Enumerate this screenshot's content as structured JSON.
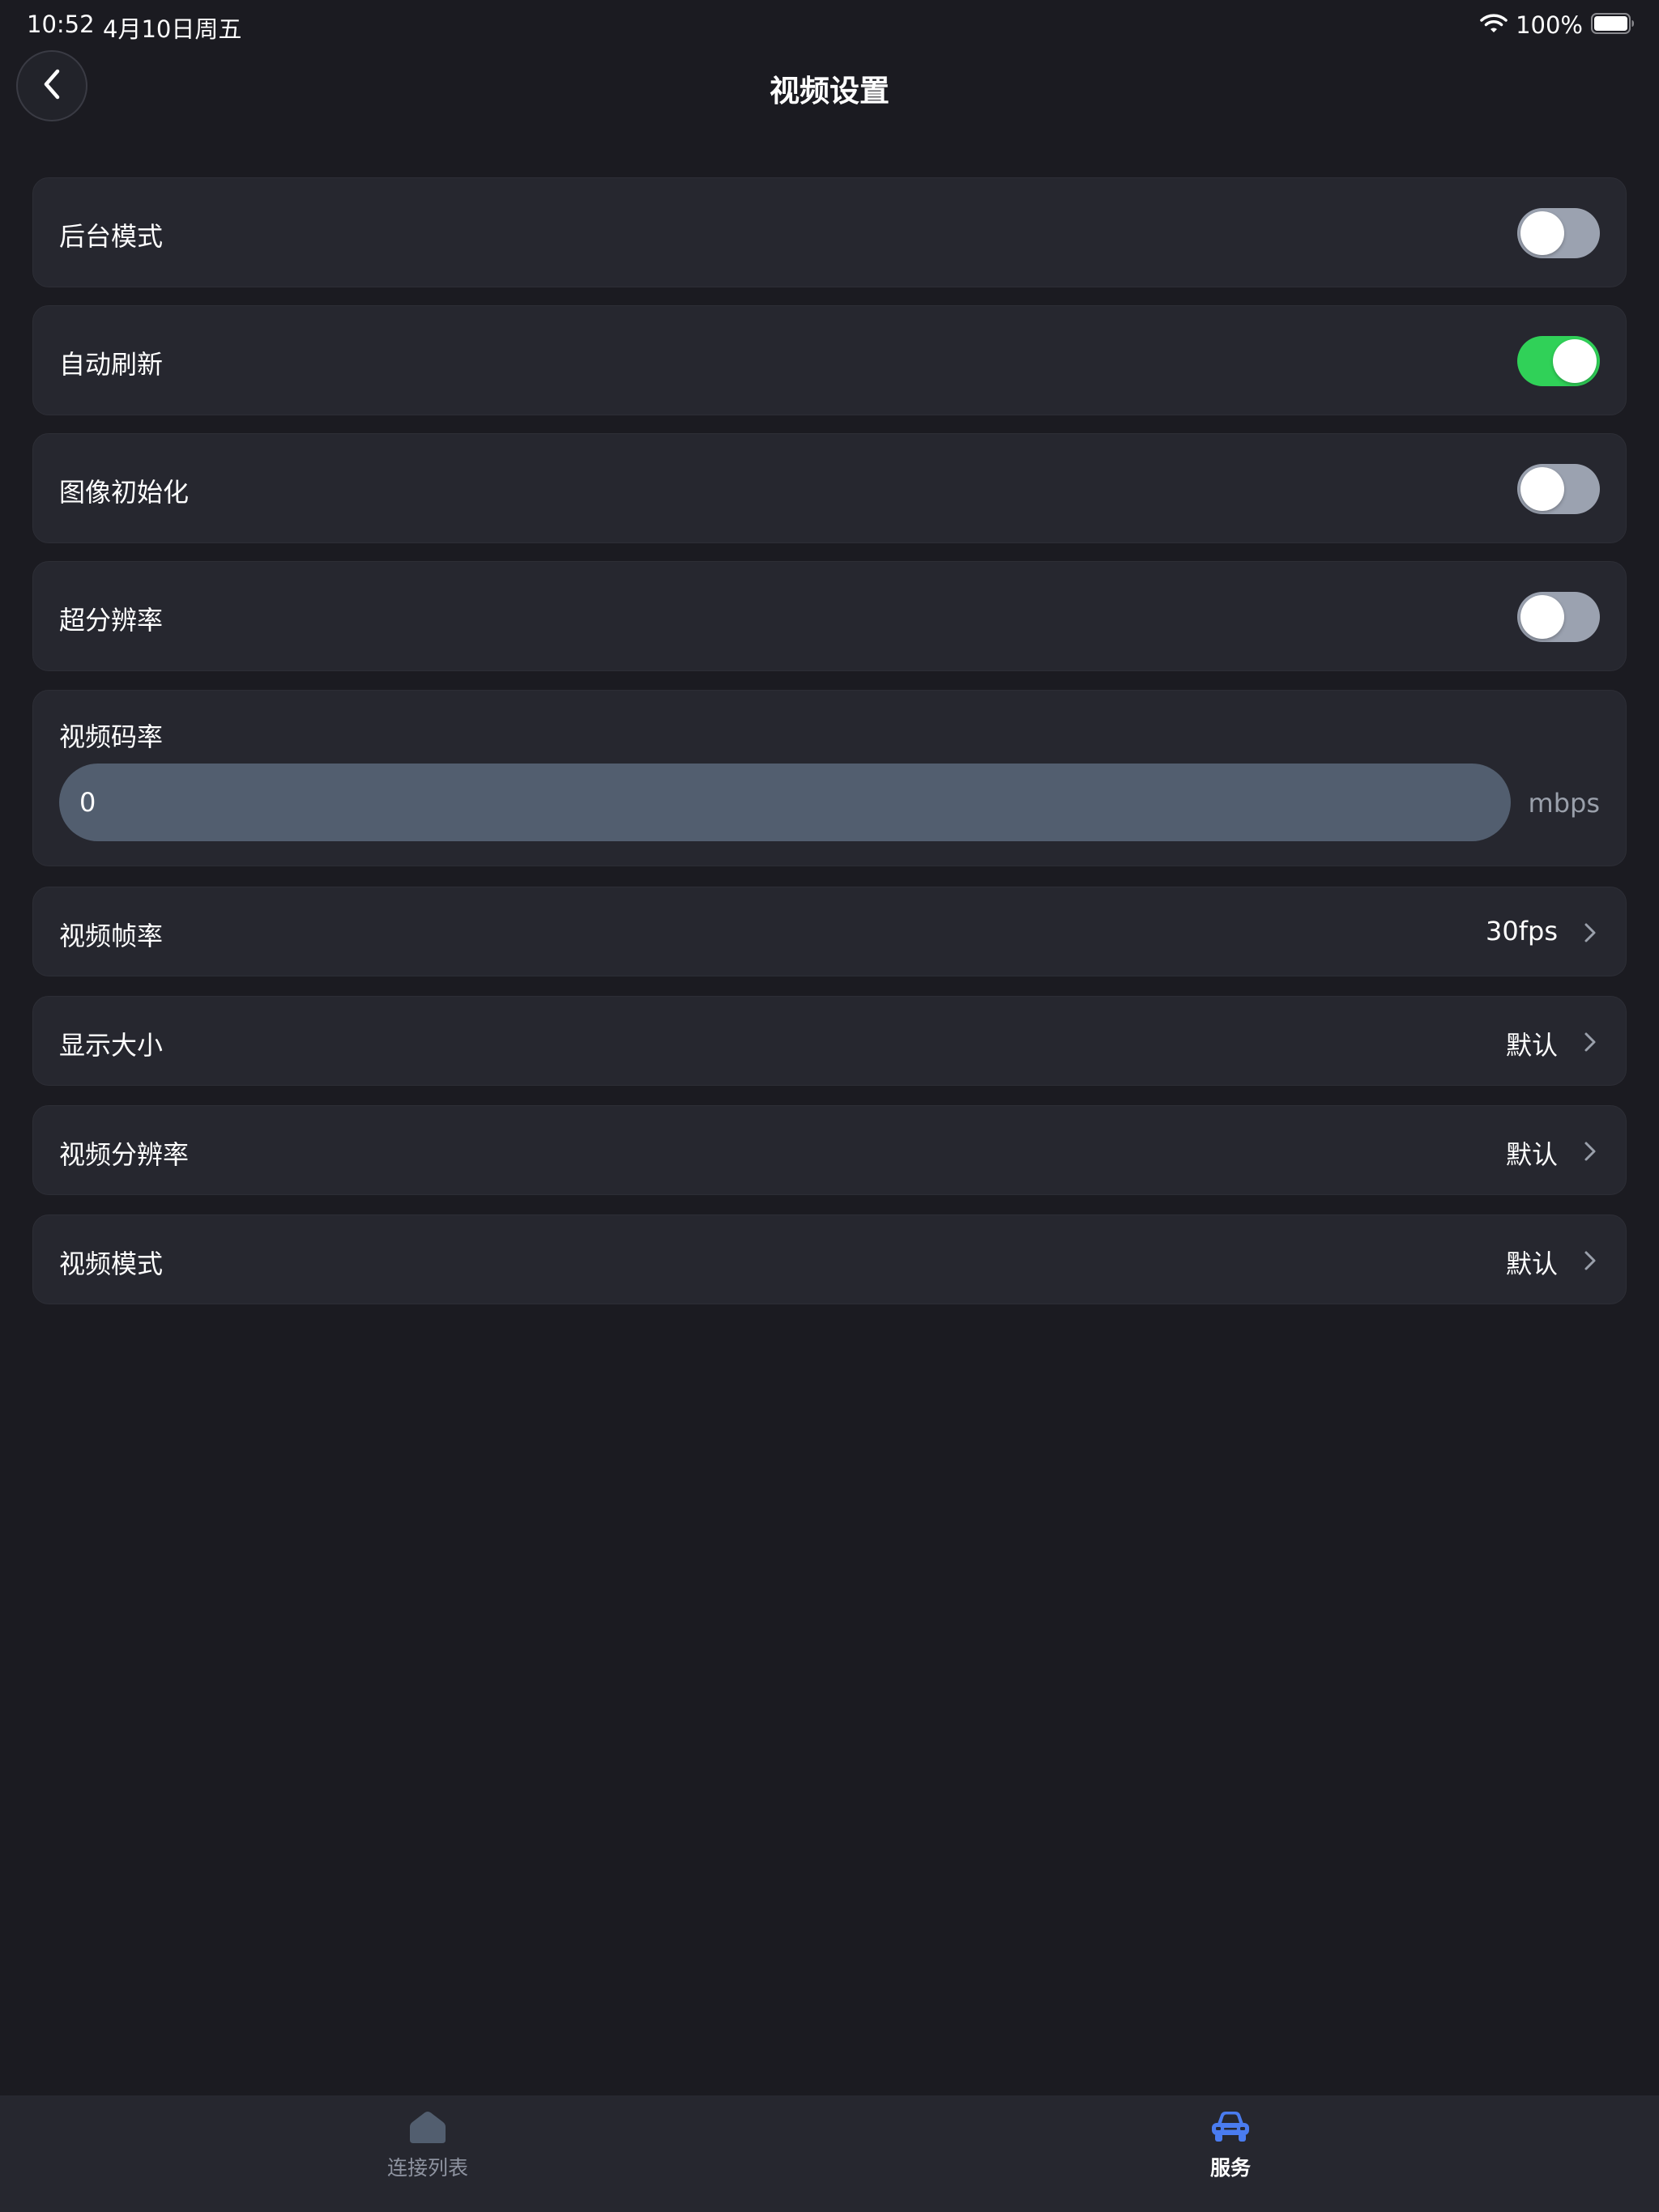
{
  "status_bar": {
    "time": "10:52",
    "date": "4月10日周五",
    "battery": "100%"
  },
  "nav": {
    "title": "视频设置"
  },
  "toggles": [
    {
      "label": "后台模式",
      "on": false
    },
    {
      "label": "自动刷新",
      "on": true
    },
    {
      "label": "图像初始化",
      "on": false
    },
    {
      "label": "超分辨率",
      "on": false
    }
  ],
  "bitrate": {
    "label": "视频码率",
    "value": "0",
    "unit": "mbps"
  },
  "options": [
    {
      "label": "视频帧率",
      "value": "30fps"
    },
    {
      "label": "显示大小",
      "value": "默认"
    },
    {
      "label": "视频分辨率",
      "value": "默认"
    },
    {
      "label": "视频模式",
      "value": "默认"
    }
  ],
  "tabbar": {
    "tabs": [
      {
        "label": "连接列表",
        "icon": "home-icon",
        "active": false
      },
      {
        "label": "服务",
        "icon": "car-icon",
        "active": true
      }
    ]
  },
  "colors": {
    "background": "#1b1b21",
    "card": "#26272f",
    "toggle_on": "#30d158",
    "toggle_off": "#9ba2b0",
    "accent": "#4a7cf0"
  }
}
